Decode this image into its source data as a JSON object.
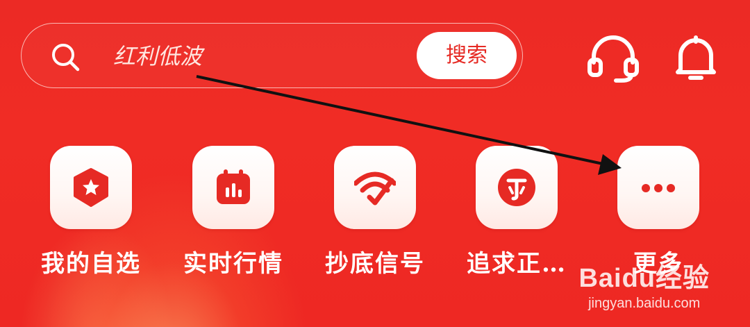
{
  "search": {
    "placeholder": "红利低波",
    "button_label": "搜索"
  },
  "header_icons": {
    "support": "headset-icon",
    "notifications": "bell-icon"
  },
  "tiles": [
    {
      "label": "我的自选",
      "icon": "star-hexagon-icon"
    },
    {
      "label": "实时行情",
      "icon": "calendar-chart-icon"
    },
    {
      "label": "抄底信号",
      "icon": "signal-check-icon"
    },
    {
      "label": "追求正…",
      "icon": "ju-coin-icon"
    },
    {
      "label": "更多",
      "icon": "more-dots-icon"
    }
  ],
  "watermark": {
    "brand": "Baidu经验",
    "url": "jingyan.baidu.com"
  },
  "colors": {
    "background": "#ee2a24",
    "accent": "#e62a24",
    "tile_background": "#ffffff"
  }
}
